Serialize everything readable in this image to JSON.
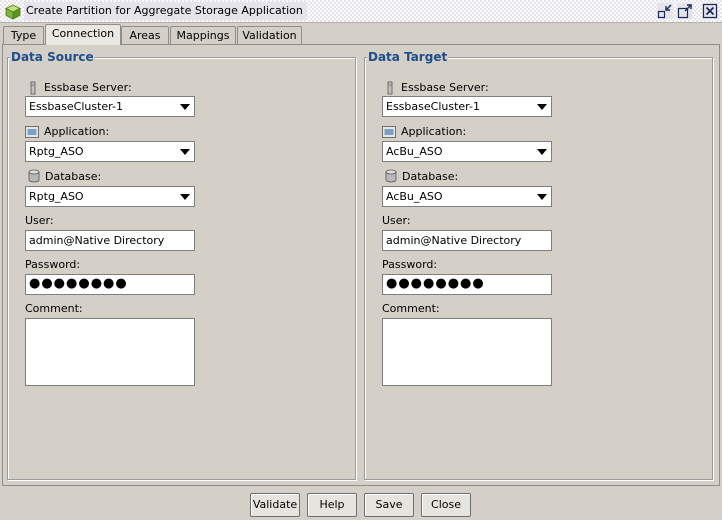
{
  "window": {
    "title": "Create Partition for Aggregate Storage Application",
    "buttons": [
      "restore-icon",
      "maximize-icon",
      "close-icon"
    ]
  },
  "tabs": [
    {
      "label": "Type",
      "active": false
    },
    {
      "label": "Connection",
      "active": true
    },
    {
      "label": "Areas",
      "active": false
    },
    {
      "label": "Mappings",
      "active": false
    },
    {
      "label": "Validation",
      "active": false
    }
  ],
  "source": {
    "title": "Data Source",
    "server_label": "Essbase Server:",
    "server_value": "EssbaseCluster-1",
    "app_label": "Application:",
    "app_value": "Rptg_ASO",
    "db_label": "Database:",
    "db_value": "Rptg_ASO",
    "user_label": "User:",
    "user_value": "admin@Native Directory",
    "password_label": "Password:",
    "password_value": "●●●●●●●●",
    "comment_label": "Comment:",
    "comment_value": ""
  },
  "target": {
    "title": "Data Target",
    "server_label": "Essbase Server:",
    "server_value": "EssbaseCluster-1",
    "app_label": "Application:",
    "app_value": "AcBu_ASO",
    "db_label": "Database:",
    "db_value": "AcBu_ASO",
    "user_label": "User:",
    "user_value": "admin@Native Directory",
    "password_label": "Password:",
    "password_value": "●●●●●●●●",
    "comment_label": "Comment:",
    "comment_value": ""
  },
  "footer": {
    "validate_label": "Validate",
    "help_label": "Help",
    "save_label": "Save",
    "close_label": "Close"
  },
  "colors": {
    "group_title": "#1f4e8c",
    "background": "#d4d0c8"
  }
}
